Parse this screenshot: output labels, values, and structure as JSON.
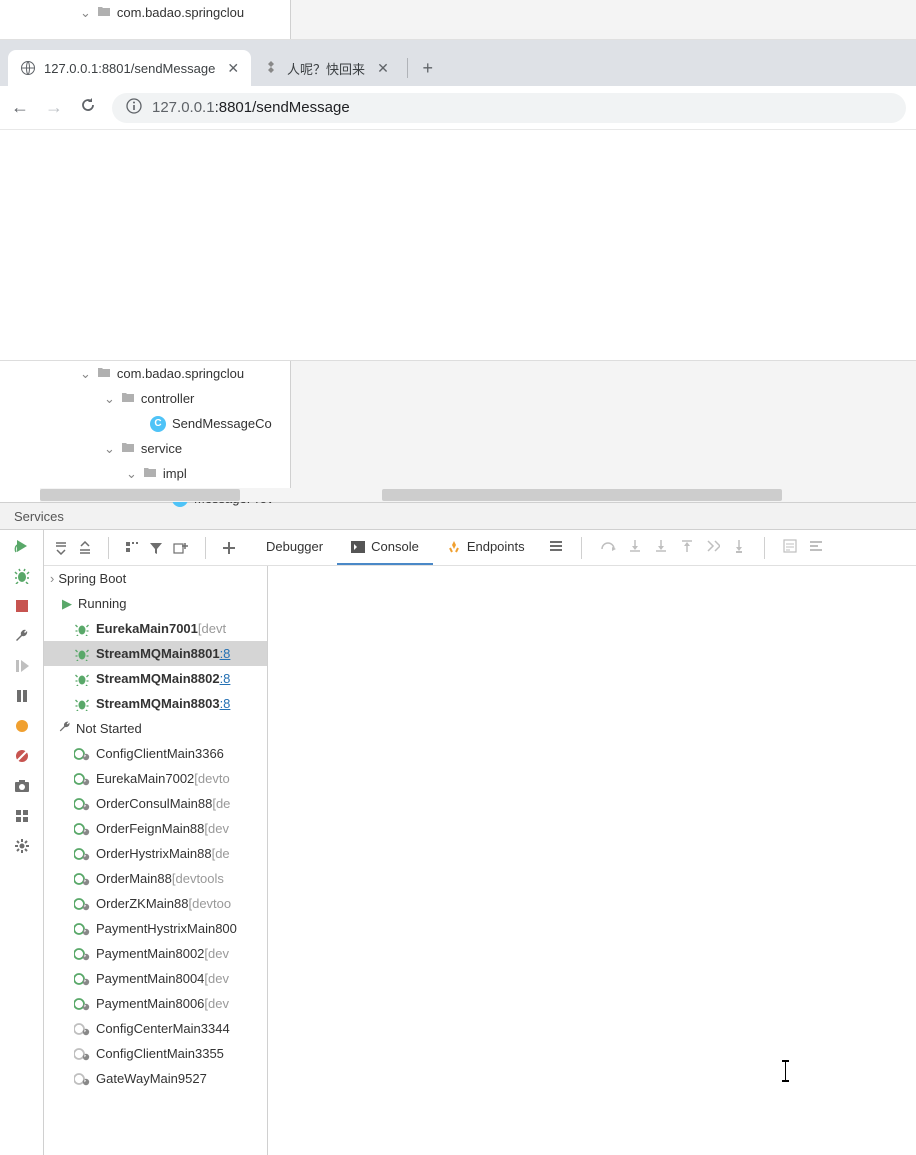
{
  "ide_top": {
    "package_name": "com.badao.springclou"
  },
  "browser": {
    "tabs": [
      {
        "title": "127.0.0.1:8801/sendMessage",
        "active": true
      },
      {
        "title": "人呢？快回来",
        "active": false
      }
    ],
    "url_host": "127.0.0.1",
    "url_port_path": ":8801/sendMessage"
  },
  "ide_mid": {
    "rows": [
      {
        "indent": 70,
        "chevron": true,
        "icon": "folder",
        "label": "com.badao.springclou"
      },
      {
        "indent": 94,
        "chevron": true,
        "icon": "folder",
        "label": "controller"
      },
      {
        "indent": 140,
        "chevron": false,
        "icon": "class",
        "label": "SendMessageCo"
      },
      {
        "indent": 94,
        "chevron": true,
        "icon": "folder",
        "label": "service"
      },
      {
        "indent": 116,
        "chevron": true,
        "icon": "folder",
        "label": "impl"
      },
      {
        "indent": 162,
        "chevron": false,
        "icon": "class",
        "label": "MessageProv"
      }
    ]
  },
  "services": {
    "header": "Services",
    "tabs": {
      "debugger": "Debugger",
      "console": "Console",
      "endpoints": "Endpoints"
    },
    "tree_root": "Spring Boot",
    "running_label": "Running",
    "running": [
      {
        "name": "EurekaMain7001",
        "suffix": "[devt",
        "link": false,
        "selected": false
      },
      {
        "name": "StreamMQMain8801",
        "suffix": ":8",
        "link": true,
        "selected": true
      },
      {
        "name": "StreamMQMain8802",
        "suffix": ":8",
        "link": true,
        "selected": false
      },
      {
        "name": "StreamMQMain8803",
        "suffix": ":8",
        "link": true,
        "selected": false
      }
    ],
    "not_started_label": "Not Started",
    "not_started": [
      {
        "name": "ConfigClientMain3366",
        "suffix": "",
        "running": true
      },
      {
        "name": "EurekaMain7002",
        "suffix": "[devto",
        "running": true
      },
      {
        "name": "OrderConsulMain88",
        "suffix": "[de",
        "running": true
      },
      {
        "name": "OrderFeignMain88",
        "suffix": "[dev",
        "running": true
      },
      {
        "name": "OrderHystrixMain88",
        "suffix": "[de",
        "running": true
      },
      {
        "name": "OrderMain88",
        "suffix": "[devtools",
        "running": true
      },
      {
        "name": "OrderZKMain88",
        "suffix": "[devtoo",
        "running": true
      },
      {
        "name": "PaymentHystrixMain800",
        "suffix": "",
        "running": true
      },
      {
        "name": "PaymentMain8002",
        "suffix": "[dev",
        "running": true
      },
      {
        "name": "PaymentMain8004",
        "suffix": "[dev",
        "running": true
      },
      {
        "name": "PaymentMain8006",
        "suffix": "[dev",
        "running": true
      },
      {
        "name": "ConfigCenterMain3344",
        "suffix": "",
        "running": false
      },
      {
        "name": "ConfigClientMain3355",
        "suffix": "",
        "running": false
      },
      {
        "name": "GateWayMain9527",
        "suffix": "",
        "running": false
      }
    ]
  }
}
